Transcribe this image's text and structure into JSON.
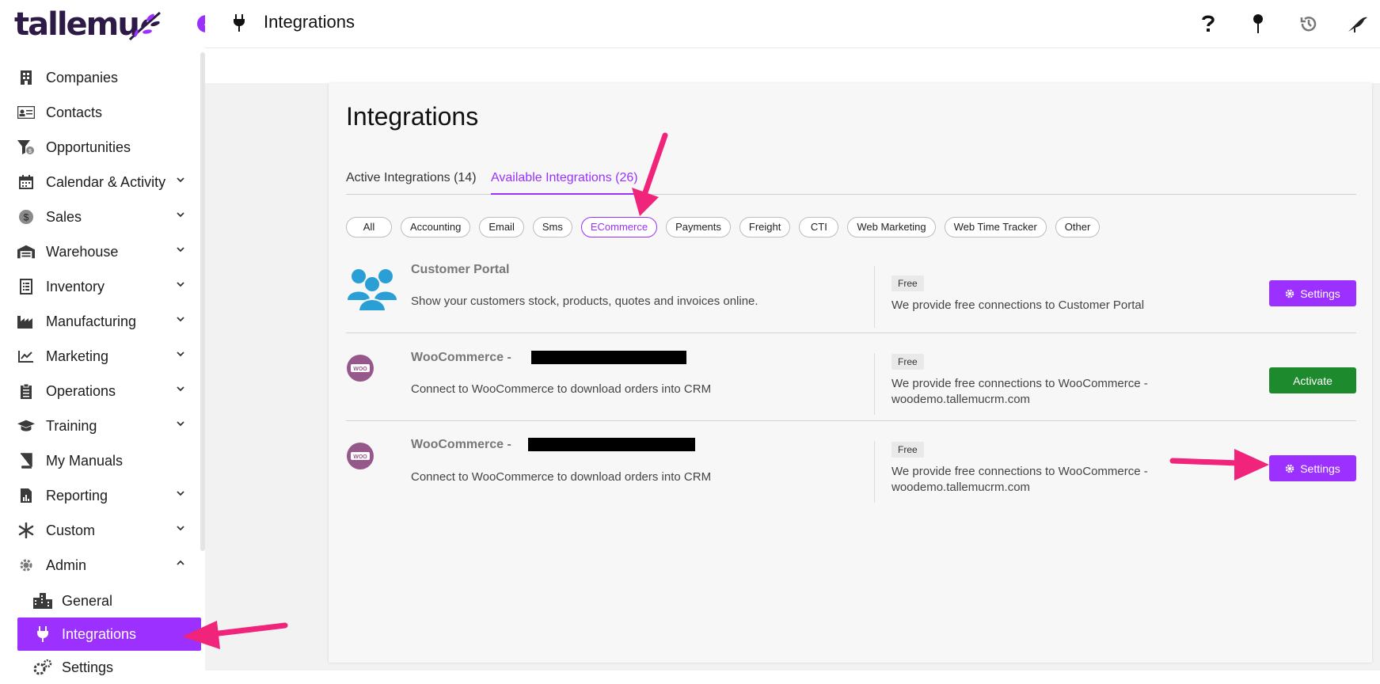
{
  "app": {
    "logo_text": "tallemu"
  },
  "header": {
    "title": "Integrations"
  },
  "sidebar": {
    "items": [
      {
        "label": "Companies",
        "icon": "building-icon",
        "expandable": false
      },
      {
        "label": "Contacts",
        "icon": "contact-card-icon",
        "expandable": false
      },
      {
        "label": "Opportunities",
        "icon": "funnel-icon",
        "expandable": false
      },
      {
        "label": "Calendar & Activity",
        "icon": "calendar-icon",
        "expandable": true
      },
      {
        "label": "Sales",
        "icon": "dollar-icon",
        "expandable": true
      },
      {
        "label": "Warehouse",
        "icon": "warehouse-icon",
        "expandable": true
      },
      {
        "label": "Inventory",
        "icon": "inventory-icon",
        "expandable": true
      },
      {
        "label": "Manufacturing",
        "icon": "factory-icon",
        "expandable": true
      },
      {
        "label": "Marketing",
        "icon": "chart-line-icon",
        "expandable": true
      },
      {
        "label": "Operations",
        "icon": "clipboard-icon",
        "expandable": true
      },
      {
        "label": "Training",
        "icon": "graduation-cap-icon",
        "expandable": true
      },
      {
        "label": "My Manuals",
        "icon": "book-icon",
        "expandable": false
      },
      {
        "label": "Reporting",
        "icon": "report-icon",
        "expandable": true
      },
      {
        "label": "Custom",
        "icon": "asterisk-icon",
        "expandable": true
      },
      {
        "label": "Admin",
        "icon": "gear-icon",
        "expandable": true,
        "expanded": true
      }
    ],
    "admin_sub": [
      {
        "label": "General",
        "icon": "city-icon"
      },
      {
        "label": "Integrations",
        "icon": "plug-icon",
        "active": true
      },
      {
        "label": "Settings",
        "icon": "gears-icon"
      }
    ]
  },
  "page": {
    "heading": "Integrations",
    "tabs": [
      {
        "label": "Active Integrations (14)",
        "active": false
      },
      {
        "label": "Available Integrations (26)",
        "active": true
      }
    ],
    "filters": [
      "All",
      "Accounting",
      "Email",
      "Sms",
      "ECommerce",
      "Payments",
      "Freight",
      "CTI",
      "Web Marketing",
      "Web Time Tracker",
      "Other"
    ],
    "active_filter": "ECommerce",
    "integrations": [
      {
        "name": "Customer Portal",
        "description": "Show your customers stock, products, quotes and invoices online.",
        "badge": "Free",
        "note": "We provide free connections to Customer Portal",
        "button": "Settings"
      },
      {
        "name": "WooCommerce -",
        "description": "Connect to WooCommerce to download orders into CRM",
        "badge": "Free",
        "note": "We provide free connections to WooCommerce - woodemo.tallemucrm.com",
        "button": "Activate"
      },
      {
        "name": "WooCommerce -",
        "description": "Connect to WooCommerce to download orders into CRM",
        "badge": "Free",
        "note": "We provide free connections to WooCommerce - woodemo.tallemucrm.com",
        "button": "Settings"
      }
    ]
  },
  "colors": {
    "accent": "#9b30ff",
    "activate": "#1e8a2e",
    "arrow": "#f0247a",
    "logo": "#2e1a47"
  }
}
